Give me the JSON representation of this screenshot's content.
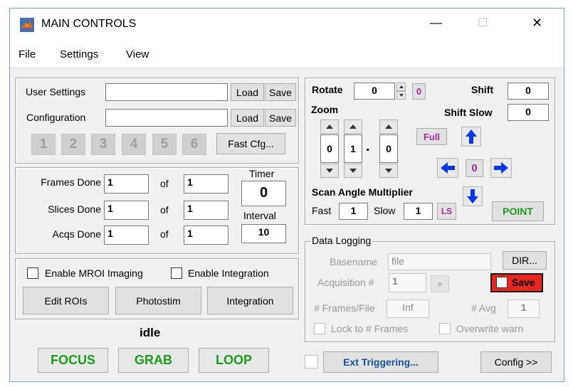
{
  "window": {
    "title": "MAIN CONTROLS",
    "minimize_glyph": "—",
    "maximize_glyph": "☐",
    "close_glyph": "✕",
    "app_icon": "matlab-icon"
  },
  "menu": [
    "File",
    "Settings",
    "View"
  ],
  "config_panel": {
    "user_settings_label": "User Settings",
    "user_settings_value": "",
    "configuration_label": "Configuration",
    "configuration_value": "",
    "load_label": "Load",
    "save_label": "Save",
    "quick_cfg": [
      "1",
      "2",
      "3",
      "4",
      "5",
      "6"
    ],
    "fast_cfg_label": "Fast Cfg..."
  },
  "counters": {
    "frames_label": "Frames Done",
    "frames_done": "1",
    "frames_total": "1",
    "slices_label": "Slices Done",
    "slices_done": "1",
    "slices_total": "1",
    "acqs_label": "Acqs Done",
    "acqs_done": "1",
    "acqs_total": "1",
    "of_label": "of",
    "timer_label": "Timer",
    "timer_value": "0",
    "interval_label": "Interval",
    "interval_value": "10"
  },
  "mroi": {
    "enable_mroi_label": "Enable MROI Imaging",
    "enable_integration_label": "Enable Integration",
    "edit_rois_label": "Edit ROIs",
    "photostim_label": "Photostim",
    "integration_label": "Integration"
  },
  "status": "idle",
  "acquisition_buttons": {
    "focus": "FOCUS",
    "grab": "GRAB",
    "loop": "LOOP"
  },
  "scan": {
    "rotate_label": "Rotate",
    "rotate_value": "0",
    "rotate_zero_label": "0",
    "shift_label": "Shift",
    "shift_value": "0",
    "shift_slow_label": "Shift Slow",
    "shift_slow_value": "0",
    "zoom_label": "Zoom",
    "zoom_digits": [
      "0",
      "1",
      "0"
    ],
    "zoom_decimal": ".",
    "full_label": "Full",
    "center_label": "0",
    "scan_angle_label": "Scan Angle Multiplier",
    "fast_label": "Fast",
    "fast_value": "1",
    "slow_label": "Slow",
    "slow_value": "1",
    "ls_label": "LS",
    "point_label": "POINT"
  },
  "data_logging": {
    "title": "Data Logging",
    "basename_label": "Basename",
    "basename_value": "file",
    "dir_label": "DIR...",
    "acq_number_label": "Acquisition #",
    "acq_number_value": "1",
    "plus_label": "+",
    "save_label": "Save",
    "frames_per_file_label": "# Frames/File",
    "frames_per_file_value": "Inf",
    "avg_label": "# Avg",
    "avg_value": "1",
    "lock_label": "Lock to # Frames",
    "overwrite_label": "Overwrite warn"
  },
  "footer": {
    "ext_triggering_label": "Ext Triggering...",
    "config_label": "Config >>"
  },
  "colors": {
    "accent_blue": "#0a35e8",
    "green_text": "#1e9b1e",
    "purple_text": "#a02ca0",
    "save_red": "#e8261f"
  }
}
